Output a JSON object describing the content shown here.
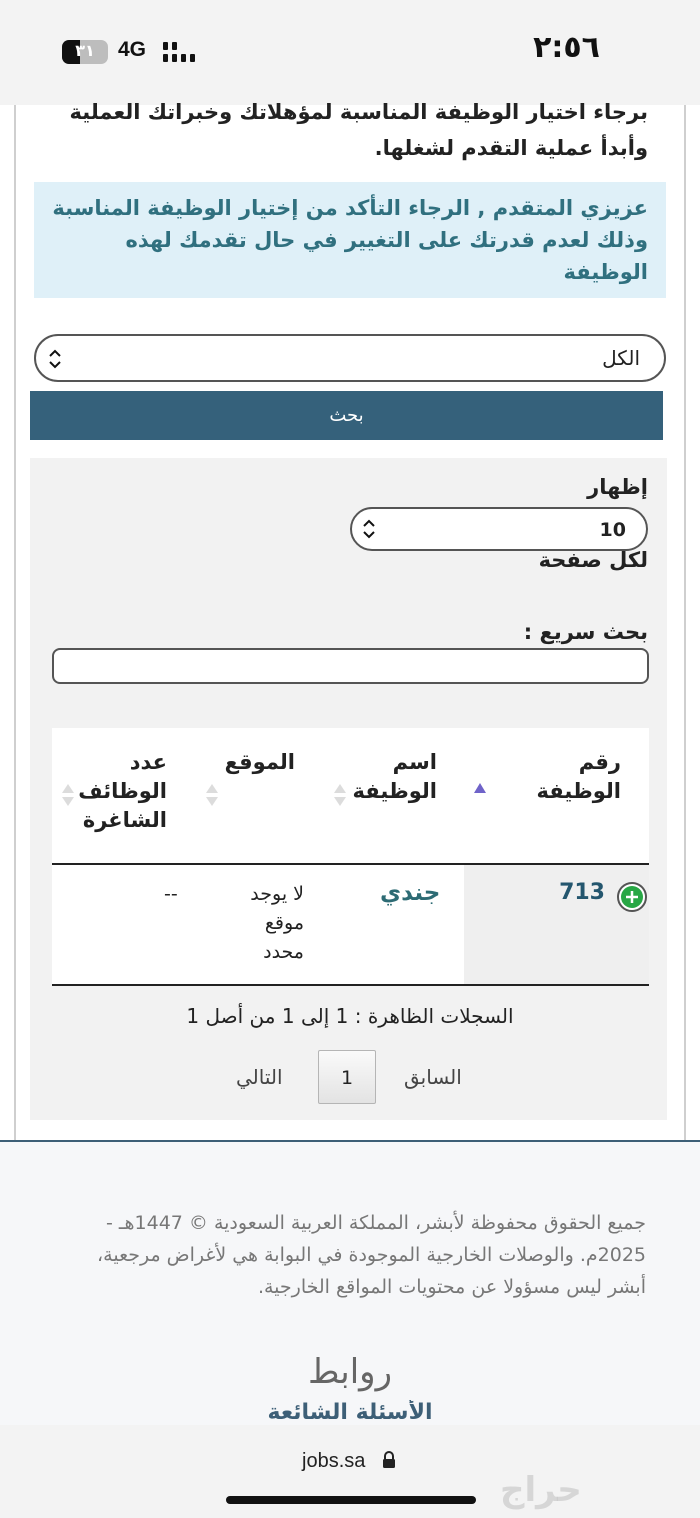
{
  "status_bar": {
    "time": "٢:٥٦",
    "network": "4G",
    "battery_level": "٣١"
  },
  "intro": {
    "text": "برجاء اختيار الوظيفة المناسبة لمؤهلاتك وخبراتك العملية وأبدأ عملية التقدم لشغلها."
  },
  "notice": {
    "text": "عزيزي المتقدم , الرجاء التأكد من إختيار الوظيفة المناسبة وذلك لعدم قدرتك على التغيير في حال تقدمك لهذه الوظيفة"
  },
  "filter": {
    "selected": "الكل",
    "search_button": "بحث"
  },
  "grid": {
    "show_label": "إظهار",
    "page_size": "10",
    "per_page_label": "لكل صفحة",
    "quick_search_label": "بحث سريع :",
    "quick_search_value": ""
  },
  "table": {
    "columns": {
      "job_number": "رقم الوظيفة",
      "job_name": "اسم الوظيفة",
      "location": "الموقع",
      "vacancies": "عدد الوظائف الشاغرة"
    },
    "rows": [
      {
        "job_number": "713",
        "job_name": "جندي",
        "location": "لا يوجد موقع محدد",
        "vacancies": "--"
      }
    ]
  },
  "pagination": {
    "records_info": "السجلات الظاهرة : 1 إلى 1 من أصل 1",
    "prev": "السابق",
    "current": "1",
    "next": "التالي"
  },
  "footer": {
    "copyright": "جميع الحقوق محفوظة لأبشر، المملكة العربية السعودية © 1447هـ - 2025م. والوصلات الخارجية الموجودة في البوابة هي لأغراض مرجعية، أبشر ليس مسؤولا عن محتويات المواقع الخارجية.",
    "links_title": "روابط",
    "faq": "الأسئلة الشائعة"
  },
  "browser": {
    "url": "jobs.sa"
  },
  "watermark": {
    "text": "حراج"
  },
  "colors": {
    "accent": "#35617b",
    "notice_bg": "#dff0f8",
    "notice_text": "#30707f",
    "link": "#2d6b74",
    "plus_green": "#28a745"
  }
}
